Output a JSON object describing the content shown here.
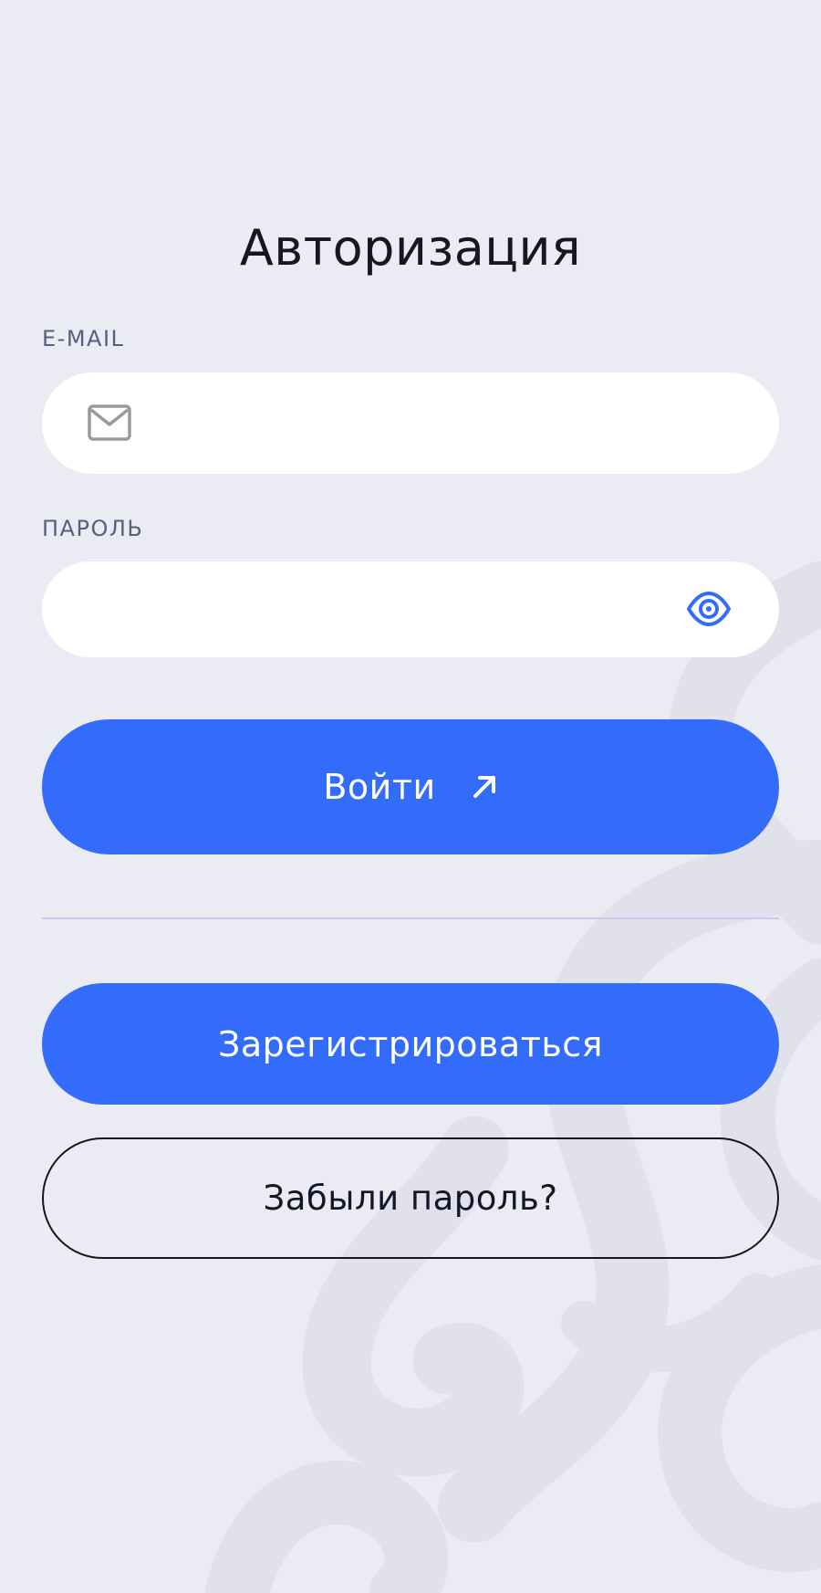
{
  "page": {
    "title": "Авторизация"
  },
  "form": {
    "email": {
      "label": "E-MAIL",
      "value": "",
      "placeholder": "",
      "icon": "mail-icon"
    },
    "password": {
      "label": "ПАРОЛЬ",
      "value": "",
      "placeholder": "",
      "icon": "eye-icon"
    }
  },
  "actions": {
    "login_label": "Войти",
    "login_icon": "arrow-up-right-icon",
    "register_label": "Зарегистрироваться",
    "forgot_label": "Забыли пароль?"
  },
  "colors": {
    "background": "#ebebf4",
    "accent": "#336bfa",
    "label": "#56607d",
    "text": "#17171f",
    "divider": "#c9c8f0",
    "ornament": "#e1e1ec"
  }
}
